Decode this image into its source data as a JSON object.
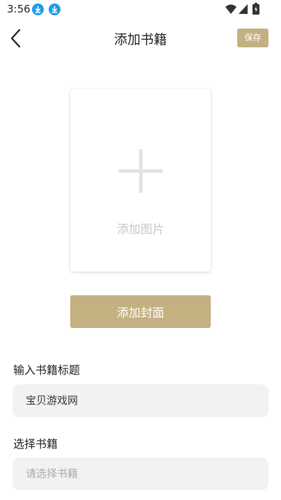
{
  "status_bar": {
    "time": "3:56",
    "icons": [
      "download-icon",
      "download-icon",
      "wifi-icon",
      "signal-icon",
      "battery-icon"
    ]
  },
  "header": {
    "back_icon": "chevron-left-icon",
    "title": "添加书籍",
    "save_label": "保存"
  },
  "cover": {
    "icon": "plus-icon",
    "label": "添加图片",
    "button_label": "添加封面"
  },
  "form": {
    "title_label": "输入书籍标题",
    "title_value": "宝贝游戏网",
    "book_label": "选择书籍",
    "book_placeholder": "请选择书籍"
  },
  "colors": {
    "accent": "#c4b181",
    "status_icon": "#1e9be8",
    "field_bg": "#f2f2f2",
    "placeholder": "#aaaaaa"
  }
}
